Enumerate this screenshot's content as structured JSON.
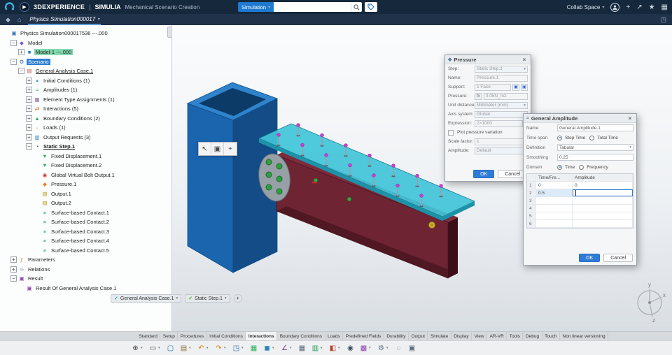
{
  "topbar": {
    "brand": "3DEXPERIENCE",
    "brand_sep": "|",
    "product": "SIMULIA",
    "module": "Mechanical Scenario Creation",
    "search_scope": "Simulation",
    "search_placeholder": "",
    "collab_label": "Collab Space",
    "right_icons": [
      {
        "name": "add-content-icon",
        "glyph": "+"
      },
      {
        "name": "share-icon",
        "glyph": "↗"
      },
      {
        "name": "favorites-icon",
        "glyph": "★"
      },
      {
        "name": "apps-grid-icon",
        "glyph": "▦"
      }
    ]
  },
  "navbar": {
    "tab_label": "Physics Simulation000017"
  },
  "tree": {
    "items": [
      {
        "label": "Physics Simulation000017536 ---.000",
        "depth": 0,
        "expander": "",
        "icon": "simulation-doc-icon",
        "glyph": "▣",
        "color": "#2e74b5"
      },
      {
        "label": "Model",
        "depth": 1,
        "expander": "minus",
        "icon": "model-node-icon",
        "glyph": "◆",
        "color": "#7a5cc6"
      },
      {
        "label": "Model-1 ---.000",
        "depth": 2,
        "expander": "plus",
        "icon": "part-icon",
        "glyph": "■",
        "color": "#2e86c1",
        "highlight": "teal"
      },
      {
        "label": "Scenario",
        "depth": 1,
        "expander": "minus",
        "icon": "scenario-node-icon",
        "glyph": "⚙",
        "color": "#2e74b5",
        "highlight": "blue"
      },
      {
        "label": "General Analysis Case.1",
        "depth": 2,
        "expander": "minus",
        "icon": "analysis-case-icon",
        "glyph": "▤",
        "color": "#c0504d",
        "underline": true
      },
      {
        "label": "Initial Conditions (1)",
        "depth": 3,
        "expander": "plus",
        "icon": "initial-conditions-icon",
        "glyph": "●",
        "color": "#5b9bd5"
      },
      {
        "label": "Amplitudes (1)",
        "depth": 3,
        "expander": "plus",
        "icon": "amplitudes-icon",
        "glyph": "≈",
        "color": "#2e9e44"
      },
      {
        "label": "Element Type Assignments (1)",
        "depth": 3,
        "expander": "plus",
        "icon": "element-type-icon",
        "glyph": "▦",
        "color": "#8064a2"
      },
      {
        "label": "Interactions (5)",
        "depth": 3,
        "expander": "plus",
        "icon": "interactions-icon",
        "glyph": "⇄",
        "color": "#d35400"
      },
      {
        "label": "Boundary Conditions (2)",
        "depth": 3,
        "expander": "plus",
        "icon": "boundary-conditions-icon",
        "glyph": "▲",
        "color": "#27ae60"
      },
      {
        "label": "Loads (1)",
        "depth": 3,
        "expander": "plus",
        "icon": "loads-icon",
        "glyph": "↓",
        "color": "#e67e22"
      },
      {
        "label": "Output Requests (3)",
        "depth": 3,
        "expander": "plus",
        "icon": "output-requests-icon",
        "glyph": "▥",
        "color": "#2980b9"
      },
      {
        "label": "Static Step.1",
        "depth": 3,
        "expander": "minus",
        "icon": "static-step-icon",
        "glyph": "◔",
        "color": "#34495e",
        "underline": true,
        "bold": true
      },
      {
        "label": "Fixed Displacement.1",
        "depth": 4,
        "expander": "",
        "icon": "fixed-displacement-icon",
        "glyph": "▼",
        "color": "#27ae60"
      },
      {
        "label": "Fixed Displacement.2",
        "depth": 4,
        "expander": "",
        "icon": "fixed-displacement-icon",
        "glyph": "▼",
        "color": "#27ae60"
      },
      {
        "label": "Global Virtual Bolt Output.1",
        "depth": 4,
        "expander": "",
        "icon": "bolt-output-icon",
        "glyph": "◉",
        "color": "#c0392b"
      },
      {
        "label": "Pressure.1",
        "depth": 4,
        "expander": "",
        "icon": "pressure-icon",
        "glyph": "◆",
        "color": "#e67e22"
      },
      {
        "label": "Output.1",
        "depth": 4,
        "expander": "",
        "icon": "output-icon",
        "glyph": "▤",
        "color": "#b7950b"
      },
      {
        "label": "Output.2",
        "depth": 4,
        "expander": "",
        "icon": "output-icon",
        "glyph": "▤",
        "color": "#b7950b"
      },
      {
        "label": "Surface-based Contact.1",
        "depth": 4,
        "expander": "",
        "icon": "contact-icon",
        "glyph": "≡",
        "color": "#16a085"
      },
      {
        "label": "Surface-based Contact.2",
        "depth": 4,
        "expander": "",
        "icon": "contact-icon",
        "glyph": "≡",
        "color": "#16a085"
      },
      {
        "label": "Surface-based Contact.3",
        "depth": 4,
        "expander": "",
        "icon": "contact-icon",
        "glyph": "≡",
        "color": "#16a085"
      },
      {
        "label": "Surface-based Contact.4",
        "depth": 4,
        "expander": "",
        "icon": "contact-icon",
        "glyph": "≡",
        "color": "#16a085"
      },
      {
        "label": "Surface-based Contact.5",
        "depth": 4,
        "expander": "",
        "icon": "contact-icon",
        "glyph": "≡",
        "color": "#16a085"
      },
      {
        "label": "Parameters",
        "depth": 1,
        "expander": "plus",
        "icon": "parameters-icon",
        "glyph": "ƒ",
        "color": "#d68910"
      },
      {
        "label": "Relations",
        "depth": 1,
        "expander": "plus",
        "icon": "relations-icon",
        "glyph": "∞",
        "color": "#7f8c8d"
      },
      {
        "label": "Result",
        "depth": 1,
        "expander": "minus",
        "icon": "result-icon",
        "glyph": "▣",
        "color": "#8e44ad"
      },
      {
        "label": "Result Of General Analysis Case.1",
        "depth": 2,
        "expander": "",
        "icon": "result-case-icon",
        "glyph": "▣",
        "color": "#8e44ad"
      }
    ]
  },
  "viewport": {
    "mini_toolbar": [
      {
        "name": "select-cursor-icon",
        "glyph": "↖"
      },
      {
        "name": "pick-filter-icon",
        "glyph": "▣"
      },
      {
        "name": "manipulate-icon",
        "glyph": "+"
      }
    ],
    "chips": [
      {
        "label": "General Analysis Case.1",
        "check": "#18a7b5"
      },
      {
        "label": "Static Step.1",
        "check": "#37b400"
      }
    ],
    "add_chip": "+",
    "triad_labels": {
      "x": "x",
      "y": "y",
      "z": "z"
    }
  },
  "pressure_dialog": {
    "title": "Pressure",
    "fields": [
      {
        "label": "Step:",
        "value": "Static Step.1",
        "kind": "select"
      },
      {
        "label": "Name:",
        "value": "Pressure.1",
        "kind": "input"
      },
      {
        "label": "Support:",
        "value": "1 Face",
        "kind": "support"
      },
      {
        "label": "Pressure:",
        "value": "0.05N_m2",
        "kind": "fx"
      },
      {
        "label": "Unit distance:",
        "value": "Millimeter (mm)",
        "kind": "select"
      },
      {
        "label": "Axis system:",
        "value": "Global",
        "kind": "select"
      },
      {
        "label": "Expression:",
        "value": "2×1000",
        "kind": "expr"
      },
      {
        "label": "Plot pressure variation",
        "kind": "checkbox"
      },
      {
        "label": "Scale factor:",
        "value": "1",
        "kind": "input"
      },
      {
        "label": "Amplitude:",
        "value": "Default",
        "kind": "select"
      }
    ],
    "ok": "OK",
    "cancel": "Cancel"
  },
  "amplitude_dialog": {
    "title": "General Amplitude",
    "name_label": "Name",
    "name_value": "General Amplitude.1",
    "time_span_label": "Time span",
    "option_step": "Step Time",
    "option_total": "Total Time",
    "definition_label": "Definition",
    "definition_value": "Tabular",
    "smoothing_label": "Smoothing",
    "smoothing_value": "0.25",
    "domain_label": "Domain",
    "domain_time": "Time",
    "domain_freq": "Frequency",
    "table": {
      "columns": [
        "",
        "Time/Fre...",
        "Amplitude"
      ],
      "rows": [
        [
          "1",
          "0",
          "0"
        ],
        [
          "2",
          "0.5",
          ""
        ],
        [
          "3",
          "",
          ""
        ],
        [
          "4",
          "",
          ""
        ],
        [
          "5",
          "",
          ""
        ],
        [
          "6",
          "",
          ""
        ]
      ],
      "active_row": 1,
      "active_col": 2
    },
    "ok": "OK",
    "cancel": "Cancel"
  },
  "bottom": {
    "tabs": [
      "Standard",
      "Setup",
      "Procedures",
      "Initial Conditions",
      "Interactions",
      "Boundary Conditions",
      "Loads",
      "Predefined Fields",
      "Durability",
      "Output",
      "Simulate",
      "Display",
      "View",
      "AR-VR",
      "Tools",
      "Debug",
      "Touch",
      "Non linear versioning"
    ],
    "active_tab": "Interactions",
    "toolbar_icons": [
      {
        "name": "zoom-area-icon",
        "glyph": "⊕",
        "color": "#4a4a4a",
        "caret": true
      },
      {
        "name": "select-box-icon",
        "glyph": "▭",
        "color": "#4a4a4a",
        "caret": true
      },
      {
        "name": "fit-view-icon",
        "glyph": "▢",
        "color": "#2e74b5",
        "caret": false
      },
      {
        "name": "clipboard-icon",
        "glyph": "▤",
        "color": "#8a6d3b",
        "caret": true
      },
      {
        "name": "undo-icon",
        "glyph": "↶",
        "color": "#d68910",
        "caret": true
      },
      {
        "name": "redo-icon",
        "glyph": "↷",
        "color": "#d68910",
        "caret": true
      },
      {
        "name": "view-cube-icon",
        "glyph": "◳",
        "color": "#2e74b5",
        "caret": true
      },
      {
        "name": "ground-grid-icon",
        "glyph": "▦",
        "color": "#27ae60",
        "caret": false
      },
      {
        "name": "part-display-icon",
        "glyph": "◼",
        "color": "#2e86c1",
        "caret": true
      },
      {
        "name": "measure-icon",
        "glyph": "∠",
        "color": "#7d3c98",
        "caret": true
      },
      {
        "name": "data-table-icon",
        "glyph": "▦",
        "color": "#5d6d7e",
        "caret": false
      },
      {
        "name": "chart-icon",
        "glyph": "▥",
        "color": "#229954",
        "caret": true
      },
      {
        "name": "paint-style-icon",
        "glyph": "◧",
        "color": "#c0392b",
        "caret": true
      },
      {
        "name": "capture-icon",
        "glyph": "◉",
        "color": "#34495e",
        "caret": false
      },
      {
        "name": "mesh-icon",
        "glyph": "▩",
        "color": "#8e44ad",
        "caret": true
      },
      {
        "name": "settings-gear-icon",
        "glyph": "⚙",
        "color": "#5d6d7e",
        "caret": true
      },
      {
        "name": "touch-mode-icon",
        "glyph": "◌",
        "color": "#5d6d7e",
        "caret": false
      },
      {
        "name": "window-layout-icon",
        "glyph": "▣",
        "color": "#5d6d7e",
        "caret": false
      }
    ]
  }
}
